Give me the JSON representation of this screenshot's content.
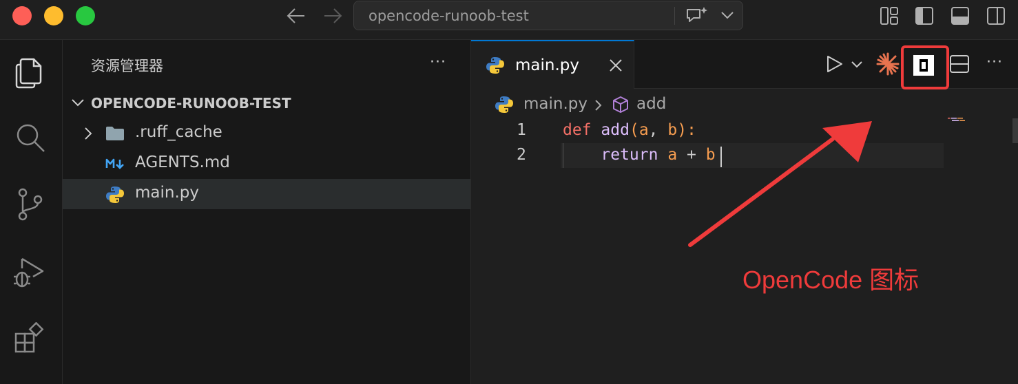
{
  "titlebar": {
    "search_text": "opencode-runoob-test",
    "back_icon": "arrow-left-icon",
    "forward_icon": "arrow-right-icon"
  },
  "sidebar": {
    "title": "资源管理器",
    "more": "···",
    "root_folder": "OPENCODE-RUNOOB-TEST",
    "items": [
      {
        "label": ".ruff_cache",
        "kind": "folder"
      },
      {
        "label": "AGENTS.md",
        "kind": "markdown"
      },
      {
        "label": "main.py",
        "kind": "python",
        "selected": true
      }
    ]
  },
  "editor": {
    "tab_label": "main.py",
    "breadcrumb": {
      "file": "main.py",
      "symbol": "add"
    },
    "more": "···",
    "lines": [
      {
        "number": "1",
        "def": "def",
        "name": "add",
        "open": "(",
        "p1": "a",
        "comma": ", ",
        "p2": "b",
        "close": "):"
      },
      {
        "number": "2",
        "ret": "return",
        "a": "a",
        "plus": " + ",
        "b": "b"
      }
    ]
  },
  "annotation": {
    "label": "OpenCode 图标",
    "color": "#ef3b3b"
  },
  "colors": {
    "accent": "#0078d4",
    "keyword": "#f47067",
    "function": "#dcbdfb",
    "param": "#f69d50",
    "sparkle": "#e8734f"
  }
}
